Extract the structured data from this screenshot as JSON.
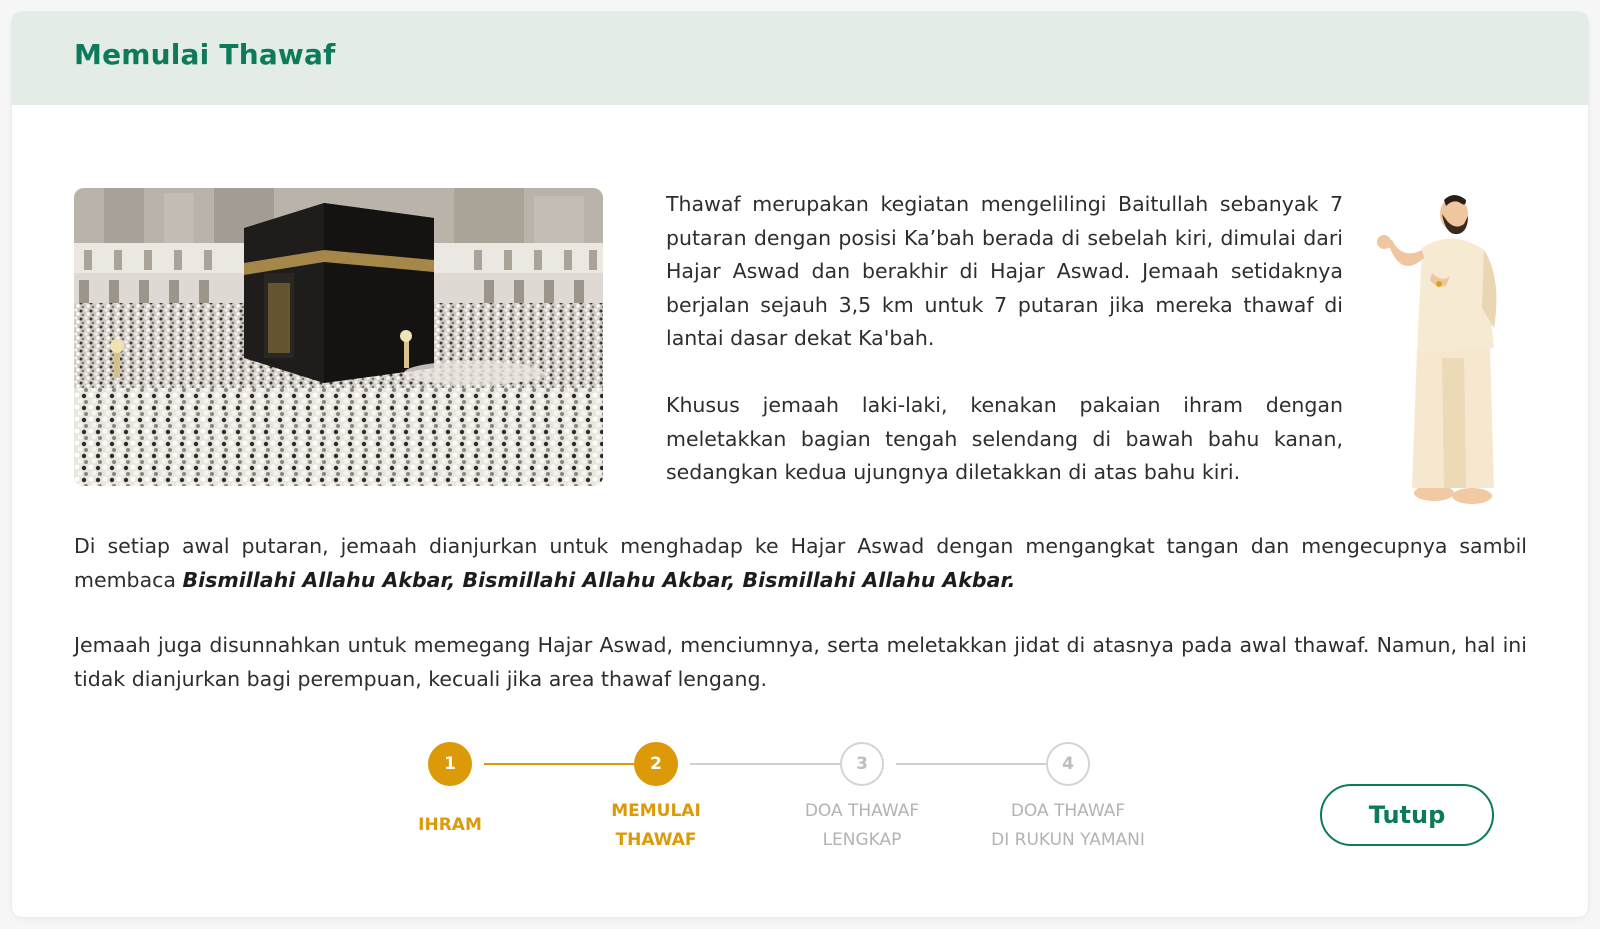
{
  "modal": {
    "title": "Memulai Thawaf",
    "paragraph1": "Thawaf merupakan kegiatan mengelilingi Baitullah sebanyak 7 putaran dengan posisi Ka’bah berada di sebelah kiri, dimulai dari Hajar Aswad dan berakhir di Hajar Aswad. Jemaah setidaknya berjalan sejauh 3,5 km untuk 7 putaran jika mereka thawaf di lantai dasar dekat Ka'bah.",
    "paragraph2": "Khusus jemaah laki-laki, kenakan pakaian ihram dengan meletakkan bagian tengah selendang di bawah bahu kanan, sedangkan kedua ujungnya diletakkan di atas bahu kiri.",
    "paragraph3_prefix": "Di setiap awal putaran, jemaah dianjurkan untuk menghadap ke Hajar Aswad dengan mengangkat tangan dan mengecupnya sambil membaca ",
    "paragraph3_bold": "Bismillahi Allahu Akbar, Bismillahi Allahu Akbar, Bismillahi Allahu Akbar.",
    "paragraph4": "Jemaah juga disunnahkan untuk memegang Hajar Aswad, menciumnya, serta meletakkan jidat di atasnya pada awal thawaf. Namun, hal ini tidak dianjurkan bagi perempuan, kecuali jika area thawaf lengang.",
    "photo_icon": "kaaba-photo",
    "illustration_icon": "pilgrim-ihram-illustration"
  },
  "stepper": {
    "steps": [
      {
        "number": "1",
        "label": "IHRAM",
        "state": "done"
      },
      {
        "number": "2",
        "label": "MEMULAI\nTHAWAF",
        "state": "active"
      },
      {
        "number": "3",
        "label": "DOA THAWAF\nLENGKAP",
        "state": "inactive"
      },
      {
        "number": "4",
        "label": "DOA THAWAF\nDI RUKUN YAMANI",
        "state": "inactive"
      }
    ]
  },
  "footer": {
    "close_label": "Tutup"
  },
  "colors": {
    "brand_green": "#0e7a5c",
    "header_bg": "#e3ece5",
    "step_active": "#dc9a08",
    "step_inactive": "#d4d4d4"
  }
}
